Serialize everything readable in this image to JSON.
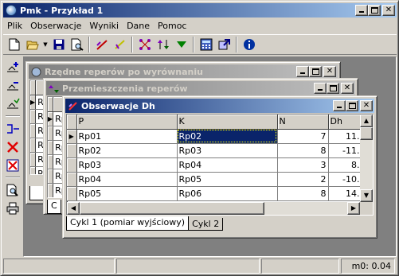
{
  "app": {
    "title": "Pmk - Przykład 1"
  },
  "menu": [
    "Plik",
    "Obserwacje",
    "Wyniki",
    "Dane",
    "Pomoc"
  ],
  "toolbar": {
    "icons": [
      "new-file-icon",
      "open-folder-icon",
      "dropdown-arrow-icon",
      "save-icon",
      "print-preview-icon",
      "draw-line-icon",
      "check-icon",
      "network-icon",
      "arrows-icon",
      "triangle-down-icon",
      "calculator-icon",
      "export-icon",
      "info-icon"
    ]
  },
  "lefttoolbar": {
    "icons": [
      "add-point-icon",
      "edit-point-icon",
      "checklist-icon",
      "merge-icon",
      "delete-icon",
      "clear-icon",
      "preview-icon",
      "print-icon"
    ]
  },
  "windows": {
    "rzedne": {
      "title": "Rzędne reperów po wyrównaniu",
      "rows": [
        "Rp",
        "Rp",
        "Rp",
        "Rp",
        "Rp",
        "Rp"
      ]
    },
    "przemieszczenia": {
      "title": "Przemieszczenia reperów",
      "rows": [
        "Rp",
        "Rp",
        "Rp",
        "Rp",
        "Rp",
        "Rp"
      ],
      "tab": "C"
    },
    "obserwacje": {
      "title": "Obserwacje Dh",
      "columns": [
        "P",
        "K",
        "N",
        "Dh"
      ],
      "rows": [
        {
          "p": "Rp01",
          "k": "Rp02",
          "n": "7",
          "dh": "11."
        },
        {
          "p": "Rp02",
          "k": "Rp03",
          "n": "8",
          "dh": "-11."
        },
        {
          "p": "Rp03",
          "k": "Rp04",
          "n": "3",
          "dh": "8."
        },
        {
          "p": "Rp04",
          "k": "Rp05",
          "n": "2",
          "dh": "-10."
        },
        {
          "p": "Rp05",
          "k": "Rp06",
          "n": "8",
          "dh": "14."
        }
      ],
      "tabs": [
        "Cykl 1 (pomiar wyjściowy)",
        "Cykl 2"
      ]
    }
  },
  "status": {
    "panel1": "",
    "panel2": "",
    "panel3": "",
    "panel4": "m0: 0.04"
  }
}
